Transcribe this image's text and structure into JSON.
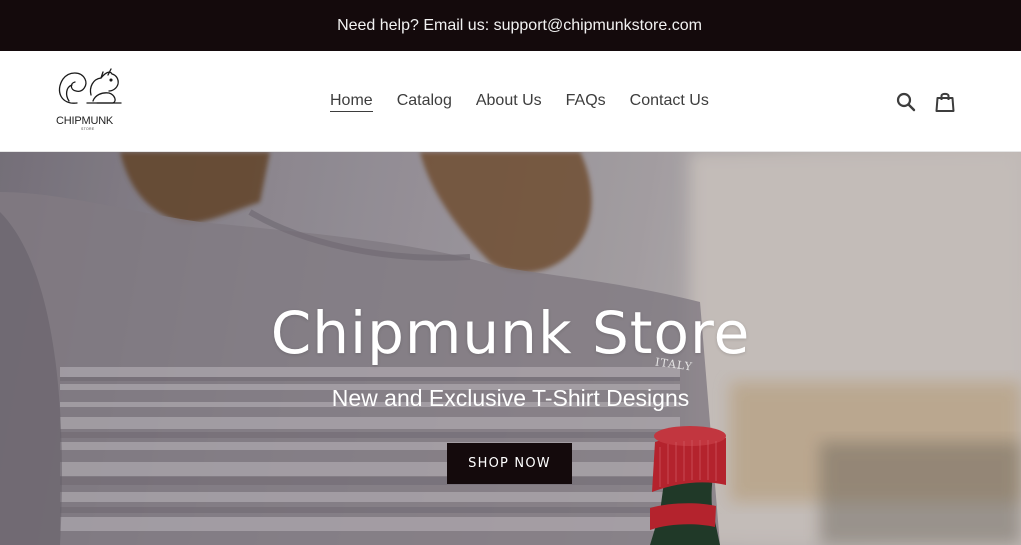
{
  "announcement": {
    "text": "Need help? Email us: support@chipmunkstore.com"
  },
  "logo": {
    "name": "CHIPMUNK",
    "sub": "STORE"
  },
  "nav": {
    "items": [
      {
        "label": "Home",
        "active": true
      },
      {
        "label": "Catalog"
      },
      {
        "label": "About Us"
      },
      {
        "label": "FAQs"
      },
      {
        "label": "Contact Us"
      }
    ]
  },
  "header_icons": [
    "search-icon",
    "cart-icon"
  ],
  "hero": {
    "title": "Chipmunk Store",
    "subtitle": "New and Exclusive T-Shirt Designs",
    "cta_label": "SHOP NOW",
    "bottle_label": "ITALY"
  },
  "colors": {
    "announcement_bg": "#140a0c",
    "button_bg": "#140a0c",
    "text": "#3d3d3d",
    "bottle_cap": "#c8242f",
    "bottle_glass": "#1f3d2a"
  }
}
